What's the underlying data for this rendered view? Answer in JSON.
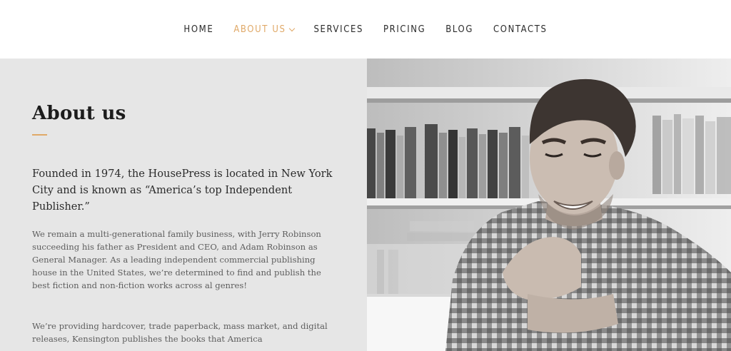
{
  "nav": {
    "items": [
      {
        "label": "HOME"
      },
      {
        "label": "ABOUT US"
      },
      {
        "label": "SERVICES"
      },
      {
        "label": "PRICING"
      },
      {
        "label": "BLOG"
      },
      {
        "label": "CONTACTS"
      }
    ]
  },
  "about": {
    "title": "About us",
    "lead": "Founded in 1974, the HousePress is located in New York City and is known as “America’s top Independent Publisher.”",
    "paragraph1": "We remain a multi-generational family business, with Jerry Robinson succeeding his father as President and CEO, and Adam Robinson as General Manager. As a leading independent commercial publishing house in the United States, we’re determined to find and publish the best fiction and non-fiction works across al genres!",
    "paragraph2": "We’re providing hardcover, trade paperback, mass market, and digital releases, Kensington publishes the books that America"
  },
  "colors": {
    "accent": "#e0a968",
    "panel_bg": "#e6e6e6",
    "text_dark": "#1c1c1c"
  },
  "icons": {
    "active_dropdown": "chevron-down-icon"
  }
}
